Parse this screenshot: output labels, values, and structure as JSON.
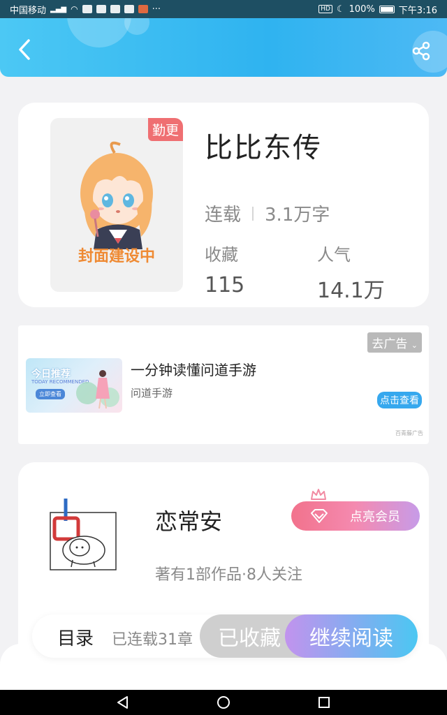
{
  "status_bar": {
    "carrier": "中国移动",
    "battery": "100%",
    "time": "下午3:16"
  },
  "header": {
    "back_icon": "back-arrow-icon",
    "share_icon": "share-icon"
  },
  "book": {
    "cover_badge": "勤更",
    "cover_text": "封面建设中",
    "title": "比比东传",
    "status": "连载",
    "word_count": "3.1万字",
    "collect_label": "收藏",
    "collect_value": "115",
    "popularity_label": "人气",
    "popularity_value": "14.1万"
  },
  "ad": {
    "close_label": "去广告",
    "image_title": "今日推荐",
    "image_subtitle": "TODAY RECOMMENDED",
    "image_button": "立即查看",
    "title": "一分钟读懂问道手游",
    "source": "问道手游",
    "cta": "点击查看",
    "tag": "百青藤广告"
  },
  "author": {
    "name": "恋常安",
    "stats": "著有1部作品·8人关注",
    "vip_button": "点亮会员"
  },
  "bottom": {
    "toc_label": "目录",
    "toc_progress": "已连载31章",
    "collected_label": "已收藏",
    "read_label": "继续阅读"
  },
  "colors": {
    "header_blue": "#2fb3f0",
    "badge_red": "#ef6f72",
    "cover_text_orange": "#ef8a33",
    "ad_cta_blue": "#36a8ee"
  }
}
